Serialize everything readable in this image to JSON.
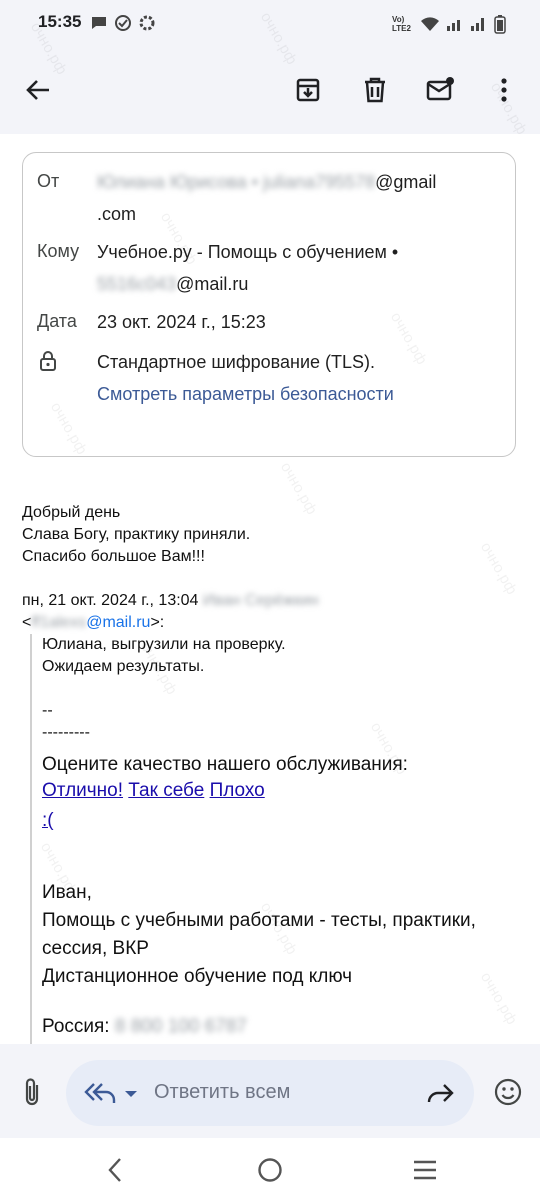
{
  "status": {
    "time": "15:35",
    "network": "Vo) LTE2"
  },
  "email": {
    "from_label": "От",
    "from_name_blurred": "Юлиана Юрисова • juliana795578",
    "from_domain": "@gmail",
    "from_domain2": ".com",
    "to_label": "Кому",
    "to_name": "Учебное.ру - Помощь с обучением •",
    "to_addr_blurred": "5516c043",
    "to_domain": "@mail.ru",
    "date_label": "Дата",
    "date_value": "23 окт. 2024 г., 15:23",
    "encryption": "Стандартное шифрование (TLS).",
    "security_link": "Смотреть параметры безопасности"
  },
  "body": {
    "line1": "Добрый день",
    "line2": "Слава Богу, практику приняли.",
    "line3": "Спасибо большое Вам!!!",
    "quote_header": "пн, 21 окт. 2024 г., 13:04",
    "quote_sender_blurred": "Иван Серёжкин",
    "quote_addr_prefix": "<",
    "quote_addr_blurred": "ff1alexs",
    "quote_addr_domain": "@mail.ru",
    "quote_addr_suffix": ">:",
    "q1": "Юлиана, выгрузили на проверку.",
    "q2": "Ожидаем результаты.",
    "q3": "--",
    "q4": "---------",
    "rate_prompt": "Оцените качество нашего обслуживания:",
    "rate_excellent": "Отлично!",
    "rate_so": "Так себе",
    "rate_bad": "Плохо",
    "rate_sad": ":(",
    "sig_name": "Иван,",
    "sig_line1": "Помощь с учебными работами - тесты, практики,",
    "sig_line2": "сессия, ВКР",
    "sig_line3": "Дистанционное обучение под ключ",
    "country_label": "Россия:",
    "phone_blurred": "8 800 100 6787"
  },
  "compose": {
    "placeholder": "Ответить всем"
  },
  "watermark": "очно.рф"
}
